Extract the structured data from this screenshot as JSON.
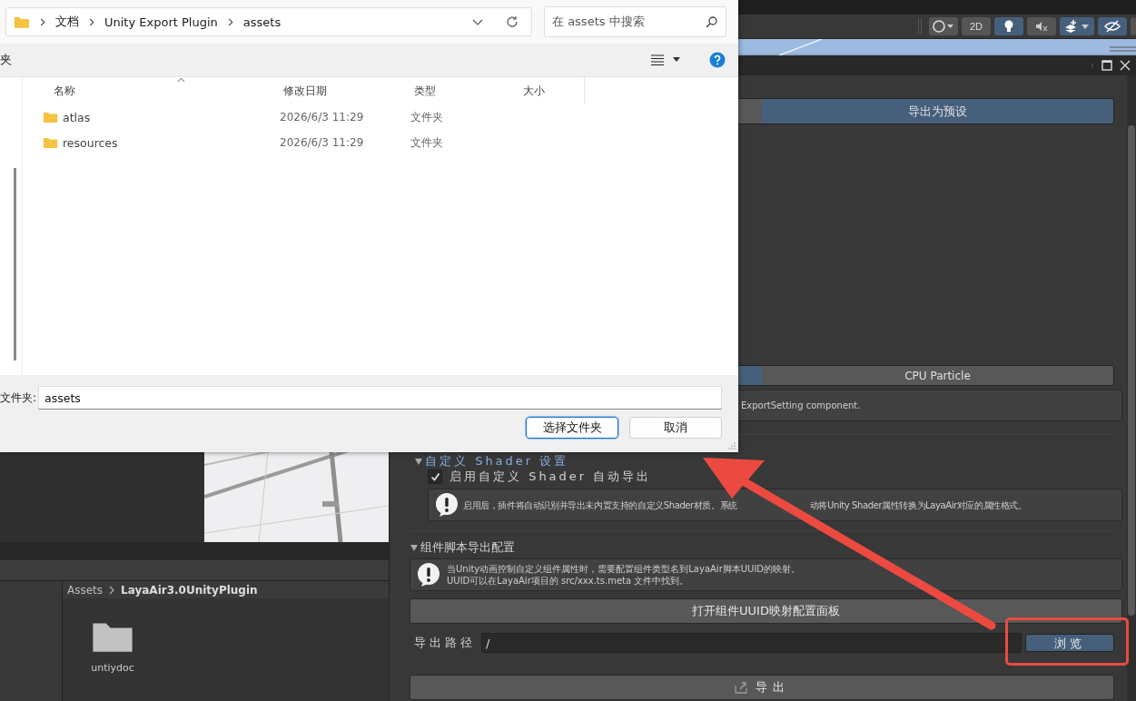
{
  "toolbar": {
    "buttons": [
      {
        "kind": "shading",
        "on": false
      },
      {
        "kind": "text",
        "label": "2D",
        "on": false
      },
      {
        "kind": "light",
        "on": true
      },
      {
        "kind": "audio",
        "on": false
      },
      {
        "kind": "effects",
        "on": true
      },
      {
        "kind": "visibility",
        "on": true
      }
    ]
  },
  "inspector": {
    "preset_tabs": [
      {
        "selected": false
      },
      {
        "label": "导出为预设",
        "selected": true
      }
    ],
    "particle_tabs": [
      {
        "selected": true
      },
      {
        "label": "CPU Particle",
        "selected": false
      }
    ],
    "particle_note": "ExportSetting component.",
    "shader_section": {
      "title": "自定义 Shader 设置",
      "expanded": true,
      "checkbox": {
        "label": "启用自定义 Shader 自动导出",
        "checked": true
      },
      "note_parts": [
        "启用后，插件将自动识别并导出未内置支持的自定义Shader材质。系统",
        "动将Unity Shader属性转换为LayaAir对应的属性格式。"
      ]
    },
    "script_section": {
      "title": "组件脚本导出配置",
      "expanded": true,
      "note_lines": [
        "当Unity动画控制自定义组件属性时，需要配置组件类型名到LayaAir脚本UUID的映射。",
        "UUID可以在LayaAir项目的 src/xxx.ts.meta 文件中找到。"
      ],
      "button": "打开组件UUID映射配置面板"
    },
    "export_path": {
      "label": "导出路径",
      "value": "/",
      "browse": "浏览"
    },
    "export_button": "导出"
  },
  "project": {
    "breadcrumb": [
      "Assets",
      "LayaAir3.0UnityPlugin"
    ],
    "items": [
      {
        "name": "untiydoc"
      }
    ]
  },
  "dialog": {
    "breadcrumb": [
      "文档",
      "Unity Export Plugin",
      "assets"
    ],
    "search_placeholder": "在 assets 中搜索",
    "toolbar_label": "夹",
    "columns": [
      "名称",
      "修改日期",
      "类型",
      "大小"
    ],
    "rows": [
      {
        "name": "atlas",
        "modified": "2026/6/3 11:29",
        "type": "文件夹",
        "selected": false
      },
      {
        "name": "resources",
        "modified": "2026/6/3 11:29",
        "type": "文件夹",
        "selected": false
      }
    ],
    "folder_label": "文件夹:",
    "folder_value": "assets",
    "buttons": [
      {
        "label": "选择文件夹",
        "default": true
      },
      {
        "label": "取消",
        "default": false
      }
    ]
  }
}
